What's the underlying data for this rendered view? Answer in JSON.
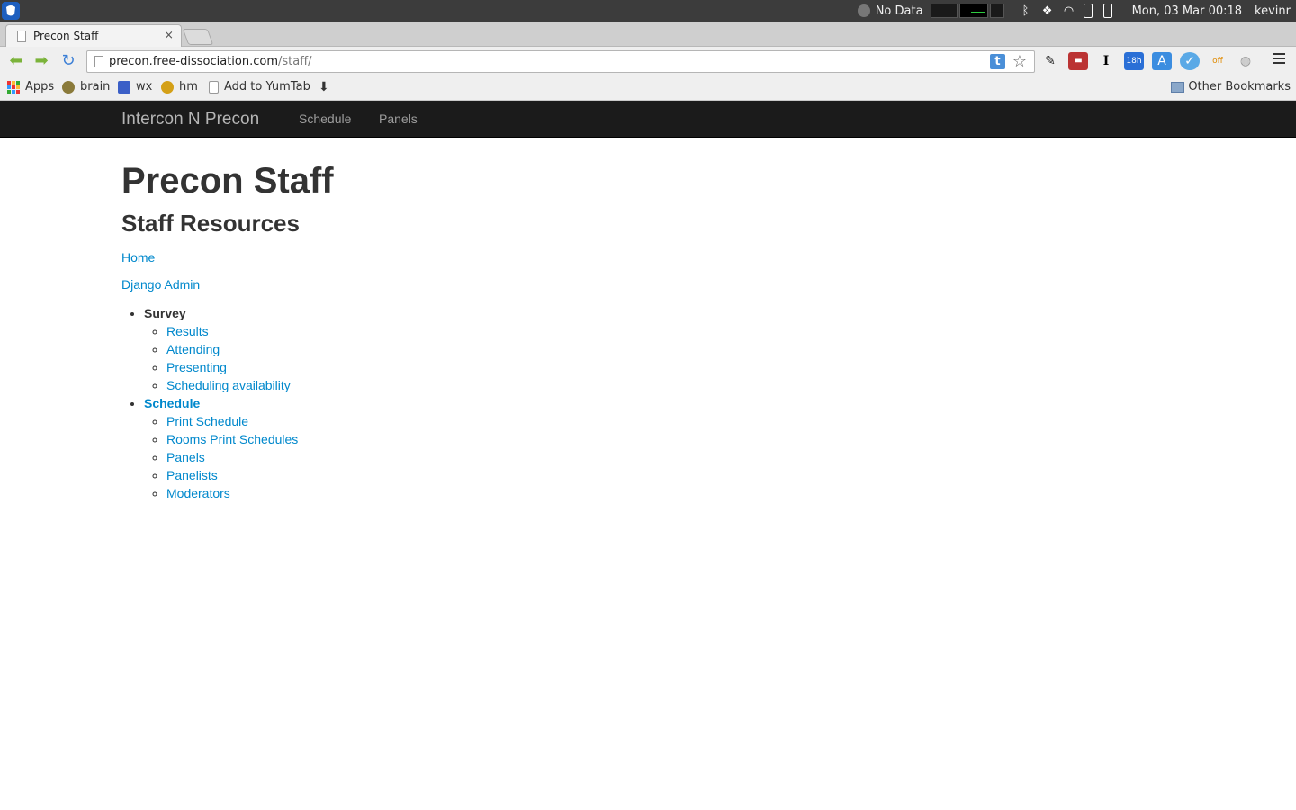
{
  "os_panel": {
    "no_data": "No Data",
    "clock": "Mon, 03 Mar  00:18",
    "user": "kevinr"
  },
  "browser": {
    "tab_title": "Precon Staff",
    "tab_close": "×",
    "url_host": "precon.free-dissociation.com",
    "url_path": "/staff/",
    "ext_t": "t"
  },
  "bookmarks": {
    "items": [
      "Apps",
      "brain",
      "wx",
      "hm",
      "Add to YumTab"
    ],
    "other": "Other Bookmarks"
  },
  "site": {
    "brand": "Intercon N Precon",
    "nav": [
      "Schedule",
      "Panels"
    ]
  },
  "page": {
    "title": "Precon Staff",
    "subtitle": "Staff Resources",
    "home": "Home",
    "django_admin": "Django Admin",
    "survey": {
      "label": "Survey",
      "items": [
        "Results",
        "Attending",
        "Presenting",
        "Scheduling availability"
      ]
    },
    "schedule": {
      "label": "Schedule",
      "items": [
        "Print Schedule",
        "Rooms Print Schedules",
        "Panels",
        "Panelists",
        "Moderators"
      ]
    }
  },
  "colors": {
    "link": "#0088cc",
    "navbar_bg": "#1b1b1b"
  }
}
